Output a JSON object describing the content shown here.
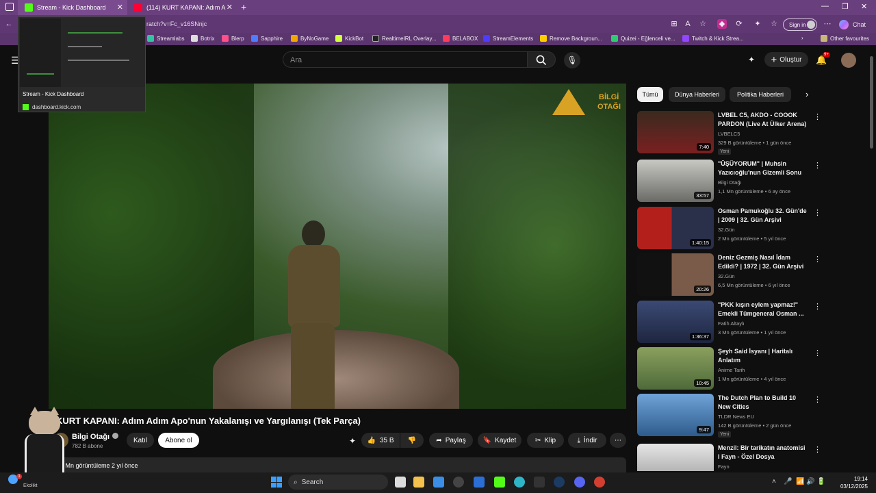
{
  "browser": {
    "tabs": [
      {
        "title": "Stream - Kick Dashboard",
        "icon": "kick-icon",
        "color": "#53fc18"
      },
      {
        "title": "(114) KURT KAPANI: Adım A",
        "icon": "youtube-icon",
        "color": "#ff0033"
      }
    ],
    "url": "ratch?v=Fc_v16SNnjc",
    "sign_in": "Sign in",
    "chat": "Chat",
    "favourites": [
      {
        "label": "Streamlabs",
        "color": "#31c3a2"
      },
      {
        "label": "Botrix",
        "color": "#dddddd"
      },
      {
        "label": "Blerp",
        "color": "#ff4f8b"
      },
      {
        "label": "Sapphire",
        "color": "#4d7cff"
      },
      {
        "label": "ByNoGame",
        "color": "#f0a500"
      },
      {
        "label": "KickBot",
        "color": "#d4ff3b"
      },
      {
        "label": "RealtimeIRL Overlay...",
        "color": "#222222"
      },
      {
        "label": "BELABOX",
        "color": "#ff3b5c"
      },
      {
        "label": "StreamElements",
        "color": "#4b3cff"
      },
      {
        "label": "Remove Backgroun...",
        "color": "#ffcc00"
      },
      {
        "label": "Quizei - Eğlenceli ve...",
        "color": "#2ecc71"
      },
      {
        "label": "Twitch & Kick Strea...",
        "color": "#9146ff"
      }
    ],
    "other_favourites": "Other favourites"
  },
  "preview": {
    "title": "Stream - Kick Dashboard",
    "url": "dashboard.kick.com"
  },
  "youtube": {
    "search_placeholder": "Ara",
    "create": "Oluştur",
    "notif_count": "9+",
    "chips": [
      "Tümü",
      "Dünya Haberleri",
      "Politika Haberleri"
    ],
    "video": {
      "logo_line1": "BİLGİ",
      "logo_line2": "OTAĞI",
      "title": "KURT KAPANI: Adım Adım Apo'nun Yakalanışı ve Yargılanışı (Tek Parça)",
      "channel": "Bilgi Otağı",
      "subscribers": "782 B abone",
      "join": "Katıl",
      "subscribe": "Abone ol",
      "likes": "35 B",
      "share": "Paylaş",
      "save": "Kaydet",
      "clip": "Klip",
      "download": "İndir",
      "description_meta": "3 Mn görüntüleme  2 yıl önce"
    },
    "recommendations": [
      {
        "title": "LVBEL C5, AKDO - COOOK PARDON (Live At Ülker Arena)",
        "channel": "LVBELC5",
        "meta": "329 B görüntüleme • 1 gün önce",
        "duration": "7:40",
        "new": "Yeni",
        "thumb": "#4a3a2a"
      },
      {
        "title": "\"ÜŞÜYORUM\" | Muhsin Yazıcıoğlu'nun Gizemli Sonu",
        "channel": "Bilgi Otağı",
        "meta": "1,1 Mn görüntüleme • 6 ay önce",
        "duration": "33:57",
        "new": "",
        "thumb": "#8a8a86"
      },
      {
        "title": "Osman Pamukoğlu 32. Gün'de | 2009 | 32. Gün Arşivi",
        "channel": "32.Gün",
        "meta": "2 Mn görüntüleme • 5 yıl önce",
        "duration": "1:40:15",
        "new": "",
        "thumb": "#2a2f4a"
      },
      {
        "title": "Deniz Gezmiş Nasıl İdam Edildi? | 1972 | 32. Gün Arşivi",
        "channel": "32.Gün",
        "meta": "6,5 Mn görüntüleme • 6 yıl önce",
        "duration": "20:26",
        "new": "",
        "thumb": "#1d1d1d"
      },
      {
        "title": "\"PKK kışın eylem yapmaz!\" Emekli Tümgeneral Osman ...",
        "channel": "Fatih Altaylı",
        "meta": "3 Mn görüntüleme • 1 yıl önce",
        "duration": "1:36:37",
        "new": "",
        "thumb": "#2b3556"
      },
      {
        "title": "Şeyh Said İsyanı | Haritalı Anlatım",
        "channel": "Anime Tarih",
        "meta": "1 Mn görüntüleme • 4 yıl önce",
        "duration": "10:45",
        "new": "",
        "thumb": "#6b7f4a"
      },
      {
        "title": "The Dutch Plan to Build 10 New Cities",
        "channel": "TLDR News EU",
        "meta": "142 B görüntüleme • 2 gün önce",
        "duration": "9:47",
        "new": "Yeni",
        "thumb": "#4c79b0"
      },
      {
        "title": "Menzil: Bir tarikatın anatomisi I Fayn - Özel Dosya",
        "channel": "Fayn",
        "meta": "",
        "duration": "",
        "new": "",
        "thumb": "#bdbdbd"
      }
    ]
  },
  "taskbar": {
    "weather": "Ekolikt",
    "weather_badge": "1",
    "search": "Search",
    "time": "19:14",
    "date": "03/12/2025"
  }
}
